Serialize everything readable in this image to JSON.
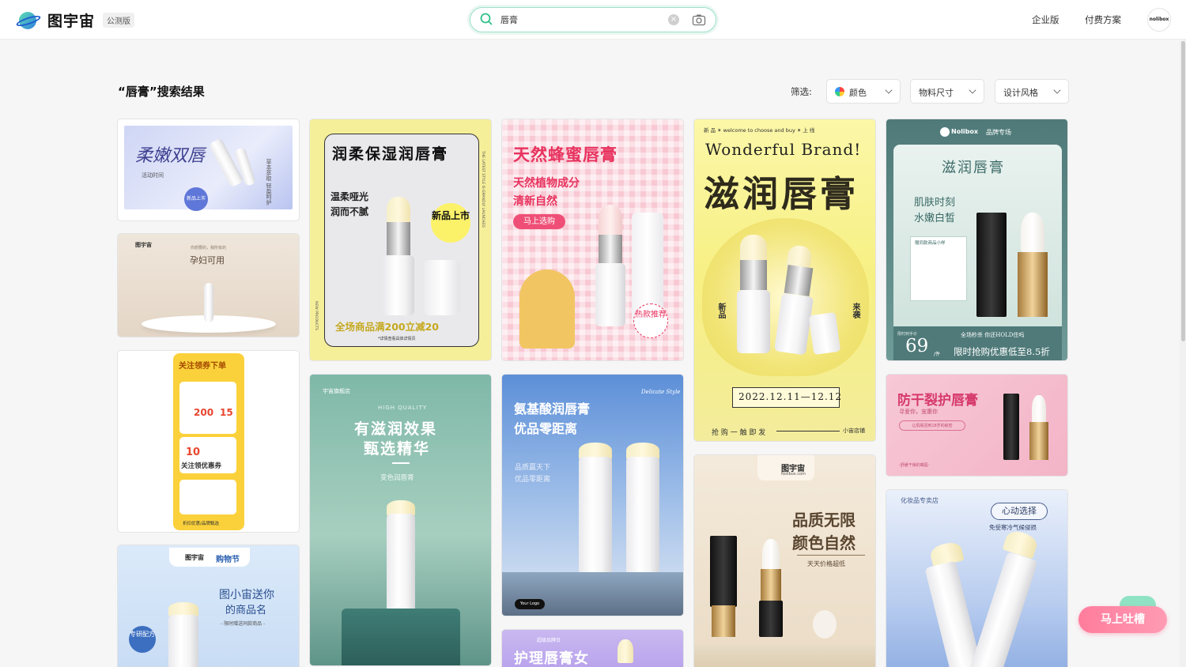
{
  "header": {
    "brand": "图宇宙",
    "beta_badge": "公测版",
    "search_value": "唇膏",
    "nav": {
      "enterprise": "企业版",
      "pricing": "付费方案"
    },
    "avatar_text": "nolibox"
  },
  "results": {
    "title": "“唇膏”搜索结果",
    "filter_label": "筛选:",
    "filters": {
      "color": "颜色",
      "size": "物料尺寸",
      "style": "设计风格"
    }
  },
  "cards": {
    "c1": {
      "title": "柔嫩双唇",
      "sub": "活动时间",
      "side": "草本萃取 轻盈呵护",
      "badge": "新品上市"
    },
    "c2": {
      "title": "孕妇可用",
      "sub": "你想要的，我所有的",
      "brand": "图宇宙"
    },
    "c3": {
      "title": "关注领券下单",
      "num1": "200",
      "num2": "15",
      "num3": "10",
      "coupon": "关注领优惠券",
      "foot": "折扣优惠/品牌甄选"
    },
    "c4": {
      "title": "图宇宙",
      "tag": "购物节",
      "line1": "图小宙送你",
      "line2": "的商品名",
      "sub": "- 限时赠送同款商品 -",
      "badge": "专研配方"
    },
    "c5": {
      "title": "润柔保湿润唇膏",
      "line1": "温柔哑光",
      "line2": "润而不腻",
      "badge": "新品上市",
      "promo": "全场商品满200立减20",
      "note": "*详情查看具体详情页",
      "side": "THE LATEST STYLE IS GRANDLY LAUNCHED",
      "side2": "NEW PRODUCTS"
    },
    "c6": {
      "brand": "宇宙旗舰店",
      "hq": "HIGH QUALITY",
      "line1": "有滋润效果",
      "line2": "甄选精华",
      "sub": "变色润唇膏"
    },
    "c7": {
      "title": "天然蜂蜜唇膏",
      "line1": "天然植物成分",
      "line2": "清新自然",
      "btn": "马上选购",
      "badge": "热款推荐"
    },
    "c8": {
      "script": "Delicate Style",
      "line1": "氨基酸润唇膏",
      "line2": "优品零距离",
      "sub1": "品质赢天下",
      "sub2": "优品零距离",
      "logo": "Your Logo"
    },
    "c9": {
      "brand": "超级品牌日",
      "title": "护理唇膏女"
    },
    "c10": {
      "top": "新 品 ✶ welcome to choose and buy ✶ 上 线",
      "brand_en": "Wonderful Brand!",
      "title": "滋润唇膏",
      "left": "新品",
      "right": "来袭",
      "date": "2022.12.11—12.12",
      "cta": "抢 购 一 触 即 发",
      "shop": "小宙店铺"
    },
    "c11": {
      "brand": "图宇宙",
      "brand_sub": "Nolibox.com",
      "line1": "品质无限",
      "line2": "颜色自然",
      "sub": "天天价格超低"
    },
    "c12": {
      "brand": "Nolibox",
      "tag": "品牌专场",
      "title": "滋润唇膏",
      "line1": "肌肤时刻",
      "line2": "水嫩白皙",
      "gift": "赠同款商品小样",
      "price": "69",
      "unit": "/件",
      "note": "全场秒杀  你还HOLD住吗",
      "promo": "限时抢购优惠低至8.5折",
      "price_label": "限时到手价"
    },
    "c13": {
      "title": "防干裂护唇膏",
      "sub": "寻爱你，宠惠你",
      "badge": "让肌肤回到18岁的秘密",
      "foot": "-舒缓干燥的嘴唇-"
    },
    "c14": {
      "shop": "化妆品专卖店",
      "badge": "心动选择",
      "sub": "免受寒冷气候侵损"
    }
  },
  "float_button": "马上吐槽",
  "colors": {
    "accent": "#2fc08a",
    "brand": "#1f5fd0",
    "float": "#ff8aa6"
  }
}
